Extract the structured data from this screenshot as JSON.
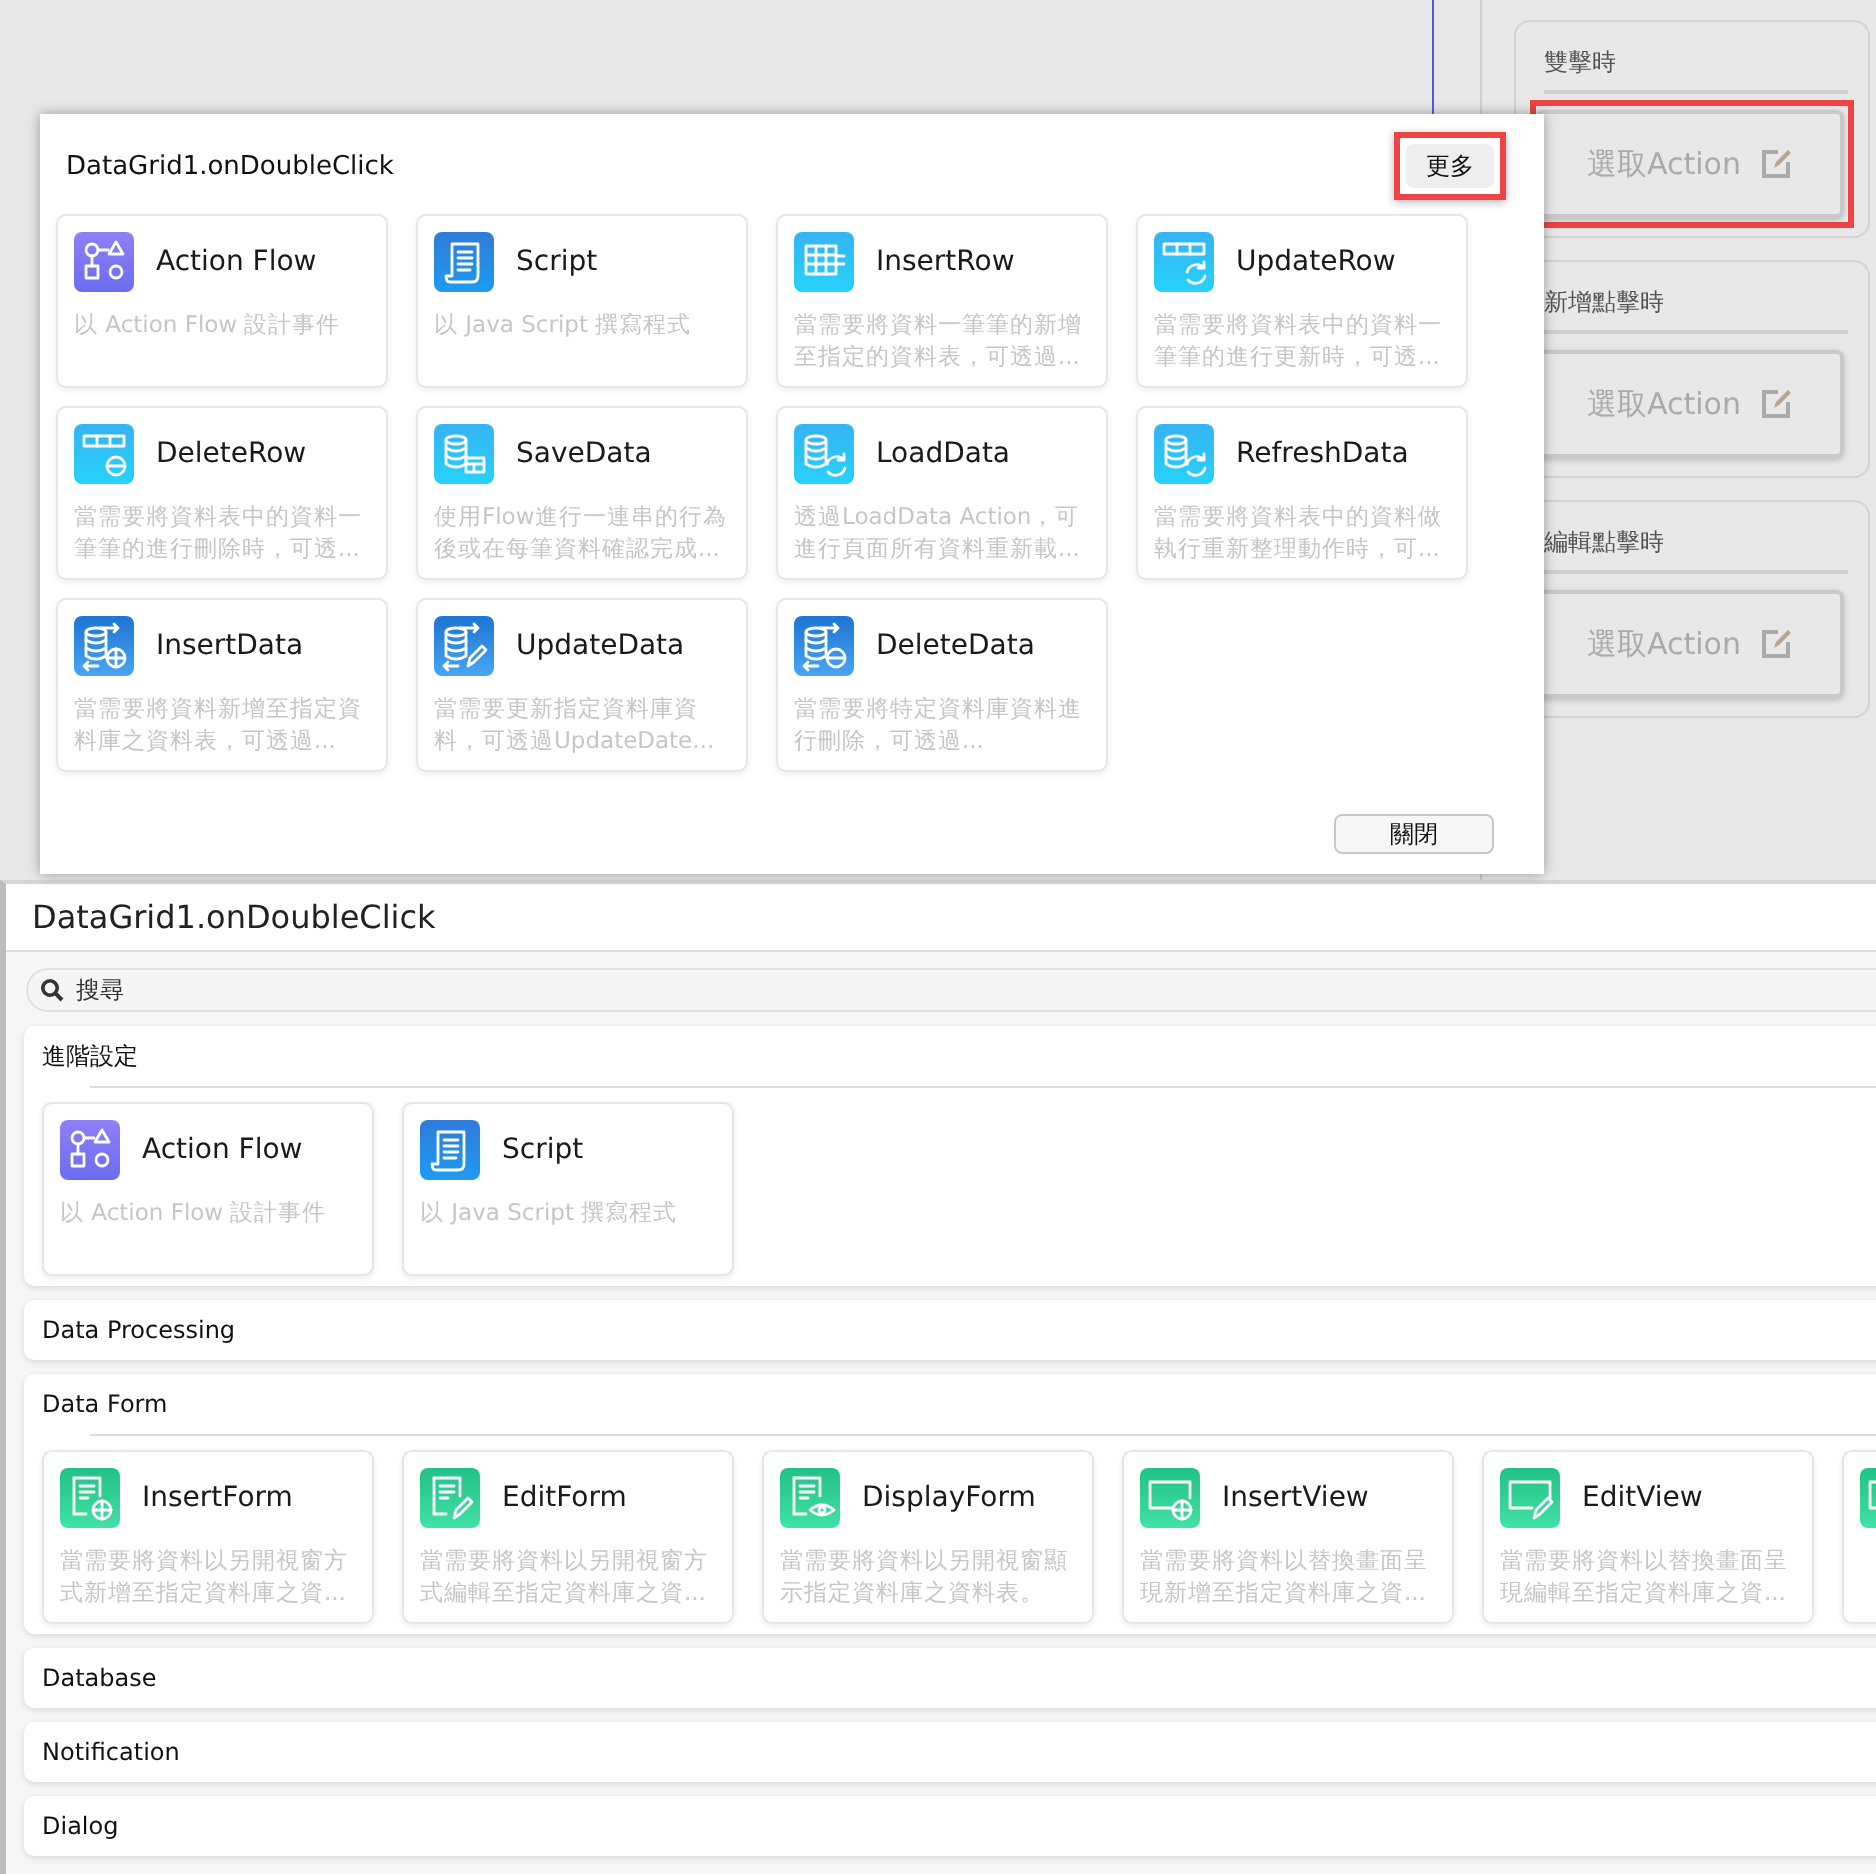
{
  "top_screen": {
    "side_panel": {
      "groups": [
        {
          "label": "雙擊時",
          "button": "選取Action",
          "highlighted": true
        },
        {
          "label": "新增點擊時",
          "button": "選取Action",
          "highlighted": false
        },
        {
          "label": "編輯點擊時",
          "button": "選取Action",
          "highlighted": false
        }
      ]
    },
    "dialog": {
      "title": "DataGrid1.onDoubleClick",
      "more_button": {
        "label": "更多",
        "highlighted": true
      },
      "cards": [
        {
          "kind": "flow",
          "title": "Action Flow",
          "description": "以 Action Flow 設計事件"
        },
        {
          "kind": "script",
          "title": "Script",
          "description": "以 Java Script 撰寫程式"
        },
        {
          "kind": "insertrow",
          "title": "InsertRow",
          "description": "當需要將資料一筆筆的新增至指定的資料表，可透過..."
        },
        {
          "kind": "updaterow",
          "title": "UpdateRow",
          "description": "當需要將資料表中的資料一筆筆的進行更新時，可透..."
        },
        {
          "kind": "deleterow",
          "title": "DeleteRow",
          "description": "當需要將資料表中的資料一筆筆的進行刪除時，可透..."
        },
        {
          "kind": "savedata",
          "title": "SaveData",
          "description": "使用Flow進行一連串的行為後或在每筆資料確認完成..."
        },
        {
          "kind": "loaddata",
          "title": "LoadData",
          "description": "透過LoadData Action，可進行頁面所有資料重新載..."
        },
        {
          "kind": "refreshdata",
          "title": "RefreshData",
          "description": "當需要將資料表中的資料做執行重新整理動作時，可..."
        },
        {
          "kind": "insertdata",
          "title": "InsertData",
          "description": "當需要將資料新增至指定資料庫之資料表，可透過..."
        },
        {
          "kind": "updatedata",
          "title": "UpdateData",
          "description": "當需要更新指定資料庫資料，可透過UpdateDate..."
        },
        {
          "kind": "deletedata",
          "title": "DeleteData",
          "description": "當需要將特定資料庫資料進行刪除，可透過..."
        }
      ],
      "close_button": "關閉"
    }
  },
  "bottom_screen": {
    "title": "DataGrid1.onDoubleClick",
    "search": {
      "placeholder": "搜尋"
    },
    "sections": [
      {
        "title": "進階設定",
        "expanded": true,
        "cards": [
          {
            "kind": "flow",
            "title": "Action Flow",
            "description": "以 Action Flow 設計事件"
          },
          {
            "kind": "script",
            "title": "Script",
            "description": "以 Java Script 撰寫程式"
          }
        ]
      },
      {
        "title": "Data Processing",
        "expanded": false
      },
      {
        "title": "Data Form",
        "expanded": true,
        "cards": [
          {
            "kind": "insertform",
            "title": "InsertForm",
            "description": "當需要將資料以另開視窗方式新增至指定資料庫之資..."
          },
          {
            "kind": "editform",
            "title": "EditForm",
            "description": "當需要將資料以另開視窗方式編輯至指定資料庫之資..."
          },
          {
            "kind": "displayform",
            "title": "DisplayForm",
            "description": "當需要將資料以另開視窗顯示指定資料庫之資料表。"
          },
          {
            "kind": "insertview",
            "title": "InsertView",
            "description": "當需要將資料以替換畫面呈現新增至指定資料庫之資..."
          },
          {
            "kind": "editview",
            "title": "EditView",
            "description": "當需要將資料以替換畫面呈現編輯至指定資料庫之資..."
          },
          {
            "kind": "view"
          }
        ]
      },
      {
        "title": "Database",
        "expanded": false
      },
      {
        "title": "Notification",
        "expanded": false
      },
      {
        "title": "Dialog",
        "expanded": false
      }
    ]
  }
}
